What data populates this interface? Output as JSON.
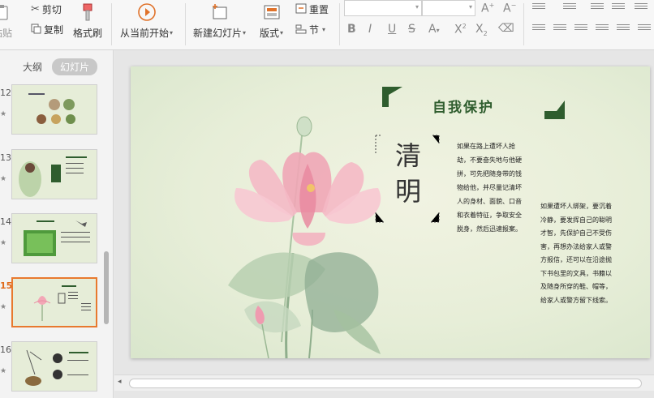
{
  "ribbon": {
    "paste_label": "粘贴",
    "cut_label": "剪切",
    "copy_label": "复制",
    "format_painter_label": "格式刷",
    "start_from_current_label": "从当前开始",
    "new_slide_label": "新建幻灯片",
    "layout_label": "版式",
    "reset_label": "重置",
    "section_label": "节"
  },
  "left_panel": {
    "tab_outline": "大纲",
    "tab_slides": "幻灯片",
    "slides": [
      {
        "number": "12",
        "active": false
      },
      {
        "number": "13",
        "active": false
      },
      {
        "number": "14",
        "active": false
      },
      {
        "number": "15",
        "active": true
      },
      {
        "number": "16",
        "active": false
      }
    ]
  },
  "slide": {
    "title": "自我保护",
    "heading_top": "清",
    "heading_bottom": "明",
    "paragraph1": "如果在路上遭坏人抢劫，不要奋失地与他硬拼，可先把随身带的钱物给他，并尽量记清坏人的身材、面貌、口音和衣着特征，争取安全脱身，然后迅速报案。",
    "paragraph2": "如果遭坏人绑架，要沉着冷静，要发挥自己的聪明才智，先保护自己不受伤害，再想办法给家人或警方报信，还可以在沿途抛下书包里的文具，书籍以及随身所穿的鞋、帽等，给家人或警方留下线索。"
  },
  "colors": {
    "accent": "#2f5d2e",
    "active_thumb": "#e8792e",
    "lotus_pink": "#e98aa0"
  }
}
